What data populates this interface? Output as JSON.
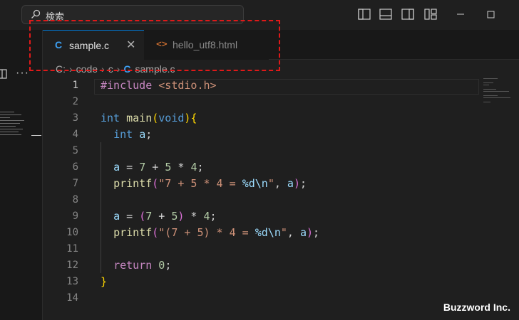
{
  "titlebar": {
    "search_placeholder": "検索"
  },
  "tabs": [
    {
      "icon": "C",
      "label": "sample.c",
      "active": true
    },
    {
      "icon": "<>",
      "label": "hello_utf8.html",
      "active": false
    }
  ],
  "breadcrumb": [
    "C:",
    "code",
    "c",
    "sample.c"
  ],
  "editor": {
    "line_numbers": [
      "1",
      "2",
      "3",
      "4",
      "5",
      "6",
      "7",
      "8",
      "9",
      "10",
      "11",
      "12",
      "13",
      "14"
    ],
    "active_line": "1"
  },
  "watermark": "Buzzword Inc.",
  "colors": {
    "accent": "#0078d4",
    "highlight_border": "#e01919",
    "c_icon": "#3da0f4",
    "html_icon": "#e37933"
  }
}
